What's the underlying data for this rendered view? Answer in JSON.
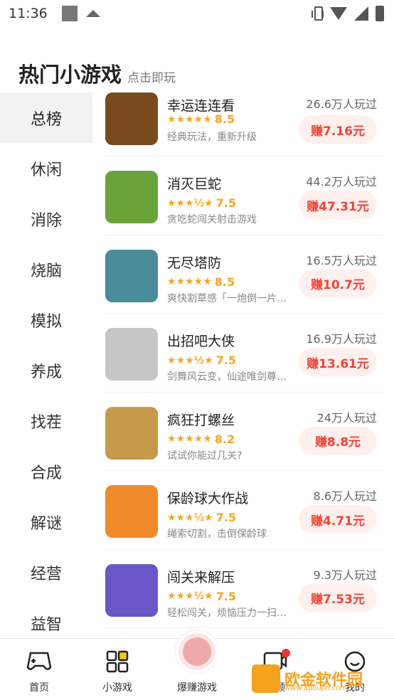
{
  "status_bar": {
    "time": "11:36"
  },
  "header": {
    "title": "热门小游戏",
    "subtitle": "点击即玩"
  },
  "sidebar": {
    "items": [
      {
        "label": "总榜",
        "active": true
      },
      {
        "label": "休闲"
      },
      {
        "label": "消除"
      },
      {
        "label": "烧脑"
      },
      {
        "label": "模拟"
      },
      {
        "label": "养成"
      },
      {
        "label": "找茬"
      },
      {
        "label": "合成"
      },
      {
        "label": "解谜"
      },
      {
        "label": "经营"
      },
      {
        "label": "益智"
      }
    ]
  },
  "games": [
    {
      "name": "幸运连连看",
      "rating": "8.5",
      "stars": "★★★★★",
      "desc": "经典玩法，重新升级",
      "players": "26.6万人玩过",
      "earn": "赚7.16元",
      "color": "#7a4a1f"
    },
    {
      "name": "消灭巨蛇",
      "rating": "7.5",
      "stars": "★★★½★",
      "desc": "贪吃蛇闯关射击游戏",
      "players": "44.2万人玩过",
      "earn": "赚47.31元",
      "color": "#6aa33a"
    },
    {
      "name": "无尽塔防",
      "rating": "8.5",
      "stars": "★★★★★",
      "desc": "爽快割草感「一炮倒一片…",
      "players": "16.5万人玩过",
      "earn": "赚10.7元",
      "color": "#4a8c9a"
    },
    {
      "name": "出招吧大侠",
      "rating": "7.5",
      "stars": "★★★½★",
      "desc": "剑舞风云变，仙途唯剑尊…",
      "players": "16.9万人玩过",
      "earn": "赚13.61元",
      "color": "#c7c7c7"
    },
    {
      "name": "疯狂打螺丝",
      "rating": "8.2",
      "stars": "★★★★★",
      "desc": "试试你能过几关?",
      "players": "24万人玩过",
      "earn": "赚8.8元",
      "color": "#c69a4a"
    },
    {
      "name": "保龄球大作战",
      "rating": "7.5",
      "stars": "★★★½★",
      "desc": "绳索切割，击倒保龄球",
      "players": "8.6万人玩过",
      "earn": "赚4.71元",
      "color": "#f08a2b"
    },
    {
      "name": "闯关来解压",
      "rating": "7.5",
      "stars": "★★★½★",
      "desc": "轻松闯关，烦恼压力一扫…",
      "players": "9.3万人玩过",
      "earn": "赚7.53元",
      "color": "#6b56c8"
    }
  ],
  "tabbar": {
    "home": "首页",
    "games": "小游戏",
    "hot": "爆赚游戏",
    "video": "视频",
    "me": "我的"
  },
  "watermark": {
    "text": "欧金软件园",
    "url": "www.apoujin.com"
  }
}
